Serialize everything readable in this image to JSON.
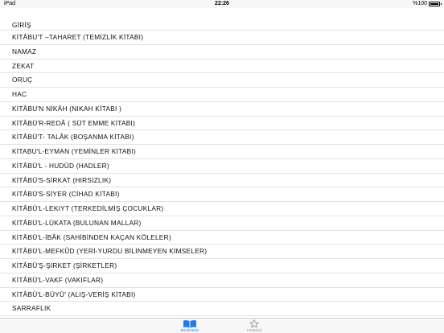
{
  "status_bar": {
    "device": "iPad",
    "time": "22:26",
    "battery": "%100"
  },
  "chapters": [
    "GİRİŞ",
    "KİTÂBU'T –TAHARET (TEMİZLİK KİTABI)",
    "NAMAZ",
    "ZEKAT",
    "ORUÇ",
    "HAC",
    "KİTÂBU'N NİKÂH (NIKAH KİTABI )",
    "KİTÂBÜ'R-REDÂ ( SÜT EMME KİTABI)",
    "KİTÂBÜ'T- TALÂK (BOŞANMA KİTABI)",
    "KİTABU'L-EYMAN (YEMİNLER KİTABI)",
    "KİTÂBÜ'L - HUDÜD (HADLER)",
    "KİTÂBÜ'S-SIRKAT (HIRSIZLIK)",
    "KİTÂBÜ'S-SİYER (CİHAD KİTABI)",
    "KİTÂBÜ'L-LEKIYT (TERKEDİLMİŞ ÇOCUKLAR)",
    "KİTÂBÜ'L-LÜKATA (BULUNAN MALLAR)",
    "KİTÂBÜ'L-İBÂK (SAHİBİNDEN KAÇAN KÖLELER)",
    "KİTÂBÜ'L-MEFKÛD (YERİ-YURDU BİLİNMEYEN KİMSELER)",
    "KİTÂBÜ'Ş-ŞİRKET (ŞİRKETLER)",
    "KİTÂBÜ'L-VAKF (VAKIFLAR)",
    "KİTÂBÜ'L-BÜYÜ' (ALIŞ-VERİŞ KİTABI)",
    "SARRAFLIK"
  ],
  "tab_bar": {
    "bookmarks_label": "Bookmarks",
    "featured_label": "Featured",
    "bookmarks_icon": "book-icon",
    "featured_icon": "star-icon",
    "active_color": "#1a7cf4",
    "inactive_color": "#8e8e93"
  }
}
